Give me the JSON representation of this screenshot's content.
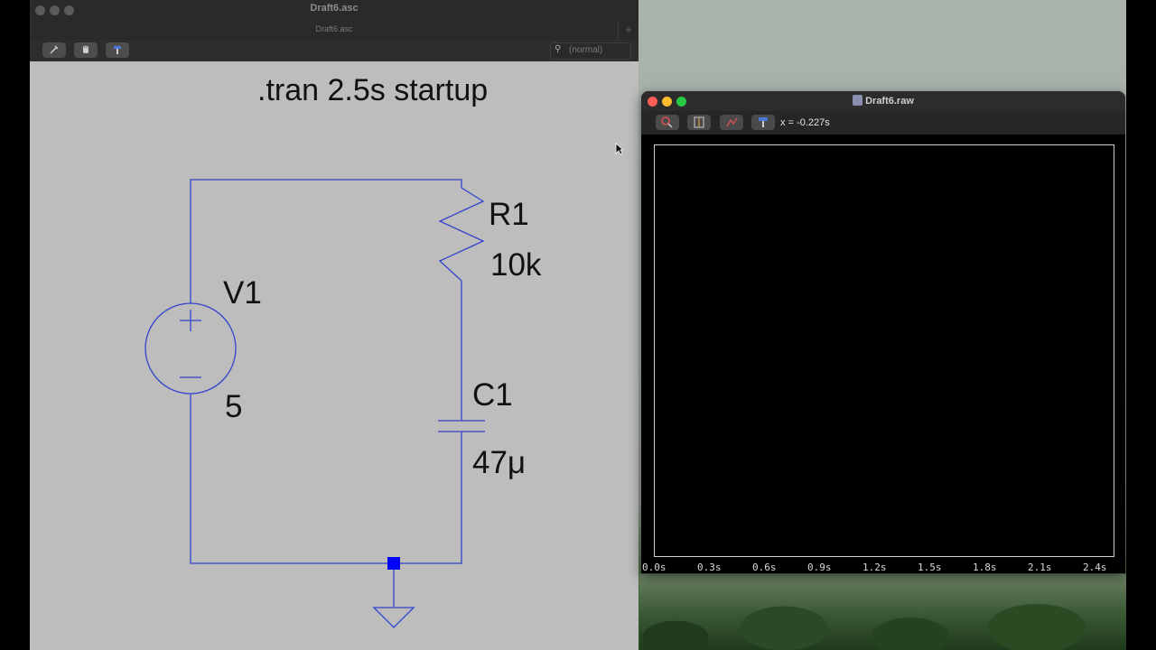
{
  "schematic_window": {
    "title": "Draft6.asc",
    "tab_label": "Draft6.asc",
    "search_placeholder": "(normal)",
    "directive": ".tran 2.5s startup",
    "components": {
      "voltage_source": {
        "name": "V1",
        "value": "5"
      },
      "resistor": {
        "name": "R1",
        "value": "10k"
      },
      "capacitor": {
        "name": "C1",
        "value": "47μ"
      }
    }
  },
  "waveform_window": {
    "title": "Draft6.raw",
    "cursor_readout": "x = -0.227s",
    "x_axis_ticks": [
      "0.0s",
      "0.3s",
      "0.6s",
      "0.9s",
      "1.2s",
      "1.5s",
      "1.8s",
      "2.1s",
      "2.4s"
    ]
  },
  "colors": {
    "wire": "#3344cc",
    "junction": "#0000ff",
    "schematic_bg": "#bdbdbd",
    "plot_bg": "#000000"
  },
  "icons": {
    "schematic_toolbar": [
      "probe-icon",
      "hand-icon",
      "hammer-icon"
    ],
    "waveform_toolbar": [
      "zoom-icon",
      "autorange-icon",
      "pan-icon",
      "hammer-icon"
    ]
  }
}
